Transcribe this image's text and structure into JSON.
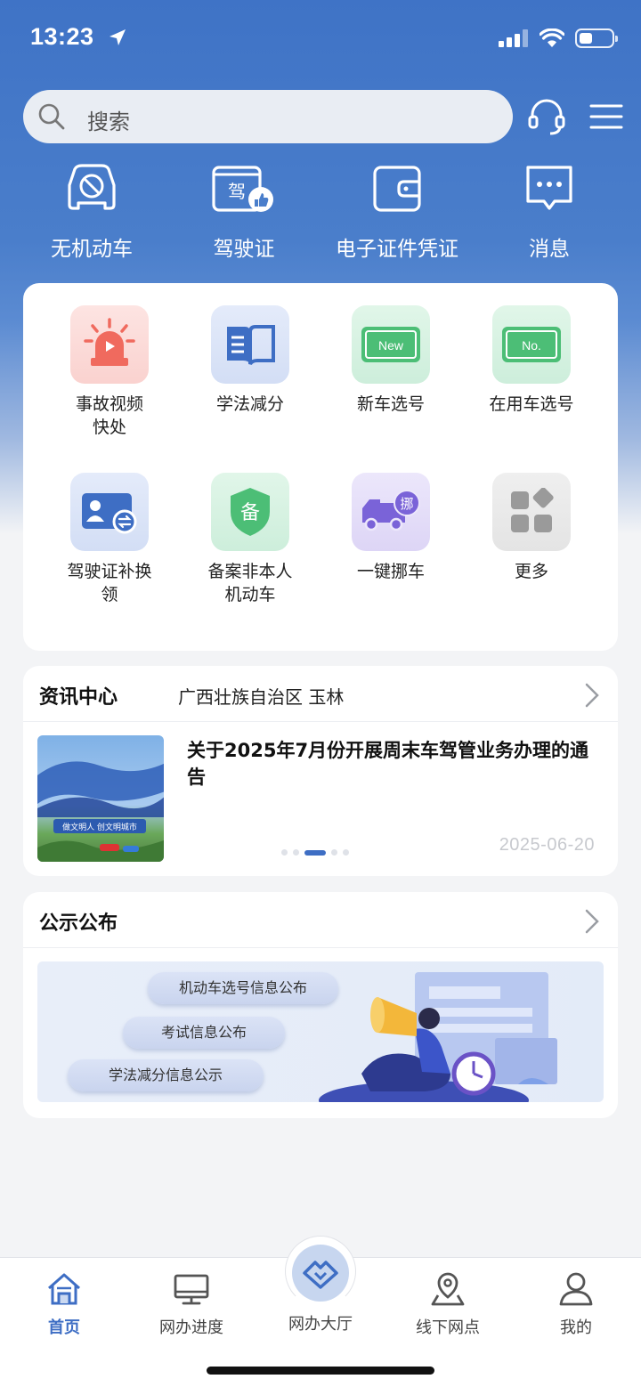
{
  "status_bar": {
    "time": "13:23"
  },
  "search": {
    "placeholder": "搜索"
  },
  "quick_actions": [
    {
      "label": "无机动车",
      "icon": "no-vehicle-icon"
    },
    {
      "label": "驾驶证",
      "icon": "license-icon",
      "icon_text": "驾"
    },
    {
      "label": "电子证件凭证",
      "icon": "wallet-icon"
    },
    {
      "label": "消息",
      "icon": "message-icon"
    }
  ],
  "services": [
    {
      "label": "事故视频快处",
      "icon": "siren-icon",
      "color": "#f06a5e"
    },
    {
      "label": "学法减分",
      "icon": "book-icon",
      "color": "#3e6ec4"
    },
    {
      "label": "新车选号",
      "icon": "plate-new-icon",
      "color": "#4cbe76",
      "icon_text": "New"
    },
    {
      "label": "在用车选号",
      "icon": "plate-no-icon",
      "color": "#4cbe76",
      "icon_text": "No."
    },
    {
      "label": "驾驶证补换领",
      "icon": "id-swap-icon",
      "color": "#3e6ec4"
    },
    {
      "label": "备案非本人机动车",
      "icon": "shield-icon",
      "color": "#4cbe76",
      "icon_text": "备"
    },
    {
      "label": "一键挪车",
      "icon": "truck-icon",
      "color": "#7a63d8",
      "icon_text": "挪"
    },
    {
      "label": "更多",
      "icon": "more-grid-icon",
      "color": "#9a9a9a"
    }
  ],
  "news": {
    "title": "资讯中心",
    "region": "广西壮族自治区 玉林",
    "headline": "关于2025年7月份开展周末车驾管业务办理的通告",
    "date": "2025-06-20",
    "thumb_text": "做文明人  创文明城市"
  },
  "notice": {
    "title": "公示公布",
    "pills": [
      "机动车选号信息公布",
      "考试信息公布",
      "学法减分信息公示"
    ]
  },
  "tabbar": [
    {
      "label": "首页",
      "icon": "home-icon",
      "active": true
    },
    {
      "label": "网办进度",
      "icon": "monitor-icon",
      "active": false
    },
    {
      "label": "网办大厅",
      "icon": "handshake-icon",
      "active": false
    },
    {
      "label": "线下网点",
      "icon": "map-pin-icon",
      "active": false
    },
    {
      "label": "我的",
      "icon": "user-icon",
      "active": false
    }
  ],
  "colors": {
    "primary": "#3e6ec4",
    "header": "#4a7ecb"
  }
}
